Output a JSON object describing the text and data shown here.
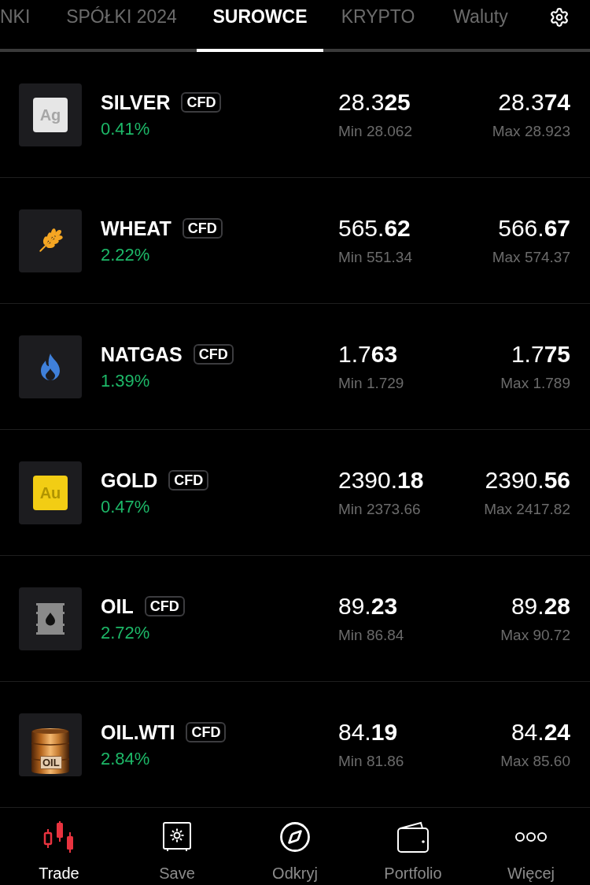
{
  "tabs": [
    {
      "label": "NKI",
      "selected": false
    },
    {
      "label": "SPÓŁKI 2024",
      "selected": false
    },
    {
      "label": "SUROWCE",
      "selected": true
    },
    {
      "label": "KRYPTO",
      "selected": false
    },
    {
      "label": "Waluty",
      "selected": false
    }
  ],
  "instruments": [
    {
      "name": "SILVER",
      "badge": "CFD",
      "change": "0.41%",
      "logo": {
        "kind": "silver",
        "text": "Ag"
      },
      "bid": "28.3**25**",
      "bid_range": "Min 28.062",
      "ask": "28.3**74**",
      "ask_range": "Max 28.923"
    },
    {
      "name": "WHEAT",
      "badge": "CFD",
      "change": "2.22%",
      "logo": {
        "kind": "wheat"
      },
      "bid": "565.**62**",
      "bid_range": "Min 551.34",
      "ask": "566.**67**",
      "ask_range": "Max 574.37"
    },
    {
      "name": "NATGAS",
      "badge": "CFD",
      "change": "1.39%",
      "logo": {
        "kind": "flame"
      },
      "bid": "1.7**63**",
      "bid_range": "Min 1.729",
      "ask": "1.7**75**",
      "ask_range": "Max 1.789"
    },
    {
      "name": "GOLD",
      "badge": "CFD",
      "change": "0.47%",
      "logo": {
        "kind": "gold",
        "text": "Au"
      },
      "bid": "2390.**18**",
      "bid_range": "Min 2373.66",
      "ask": "2390.**56**",
      "ask_range": "Max 2417.82"
    },
    {
      "name": "OIL",
      "badge": "CFD",
      "change": "2.72%",
      "logo": {
        "kind": "drum"
      },
      "bid": "89.**23**",
      "bid_range": "Min 86.84",
      "ask": "89.**28**",
      "ask_range": "Max 90.72"
    },
    {
      "name": "OIL.WTI",
      "badge": "CFD",
      "change": "2.84%",
      "logo": {
        "kind": "barrel",
        "text": "OIL"
      },
      "bid": "84.**19**",
      "bid_range": "Min 81.86",
      "ask": "84.**24**",
      "ask_range": "Max 85.60"
    }
  ],
  "nav": [
    {
      "label": "Trade",
      "kind": "candles",
      "selected": true
    },
    {
      "label": "Save",
      "kind": "safe",
      "selected": false
    },
    {
      "label": "Odkryj",
      "kind": "compass",
      "selected": false
    },
    {
      "label": "Portfolio",
      "kind": "wallet",
      "selected": false
    },
    {
      "label": "Więcej",
      "kind": "dots",
      "selected": false
    }
  ]
}
